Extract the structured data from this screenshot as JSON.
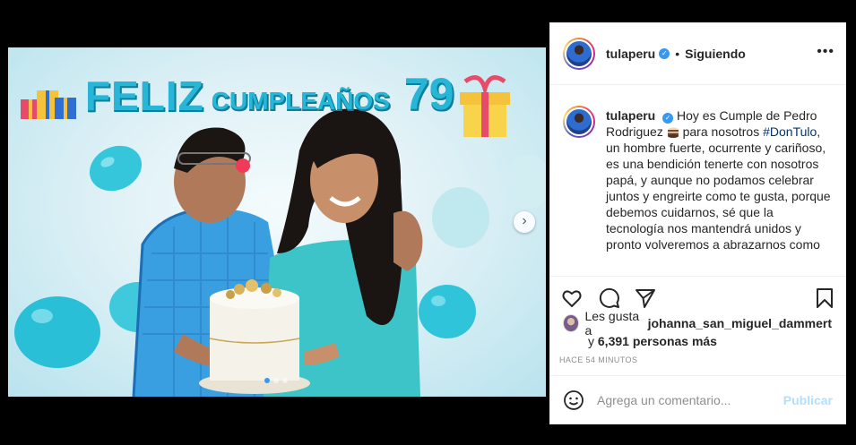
{
  "post": {
    "banner": {
      "word1": "FELIZ",
      "word2": "CUMPLEAÑOS",
      "word3": "79"
    },
    "carousel": {
      "next_arrow": "›",
      "dots": 3,
      "active_dot": 0
    }
  },
  "header": {
    "username": "tulaperu",
    "separator": "•",
    "follow_status": "Siguiendo",
    "more": "•••"
  },
  "caption": {
    "username": "tulaperu",
    "text_1": "Hoy es Cumple de Pedro Rodriguez",
    "text_2": "para nosotros",
    "hashtag": "#DonTulo",
    "text_3": ", un hombre fuerte, ocurrente y cariñoso, es una bendición tenerte con nosotros papá, y aunque no podamos celebrar juntos y engreirte como te gusta, porque debemos cuidarnos, sé que la tecnología nos mantendrá unidos y pronto volveremos a abrazarnos como"
  },
  "likes": {
    "prefix": "Les gusta a",
    "user": "johanna_san_miguel_dammert",
    "and": "y",
    "count": "6,391 personas más"
  },
  "time": "HACE 54 MINUTOS",
  "comment": {
    "placeholder": "Agrega un comentario...",
    "publish": "Publicar"
  },
  "colors": {
    "accent": "#3897f0",
    "link": "#00376b",
    "publish_disabled": "#b2dffc",
    "banner": "#27b6d8"
  },
  "icons": [
    "heart-icon",
    "comment-icon",
    "share-icon",
    "bookmark-icon",
    "emoji-icon",
    "verified-icon",
    "more-icon",
    "chevron-right-icon"
  ]
}
